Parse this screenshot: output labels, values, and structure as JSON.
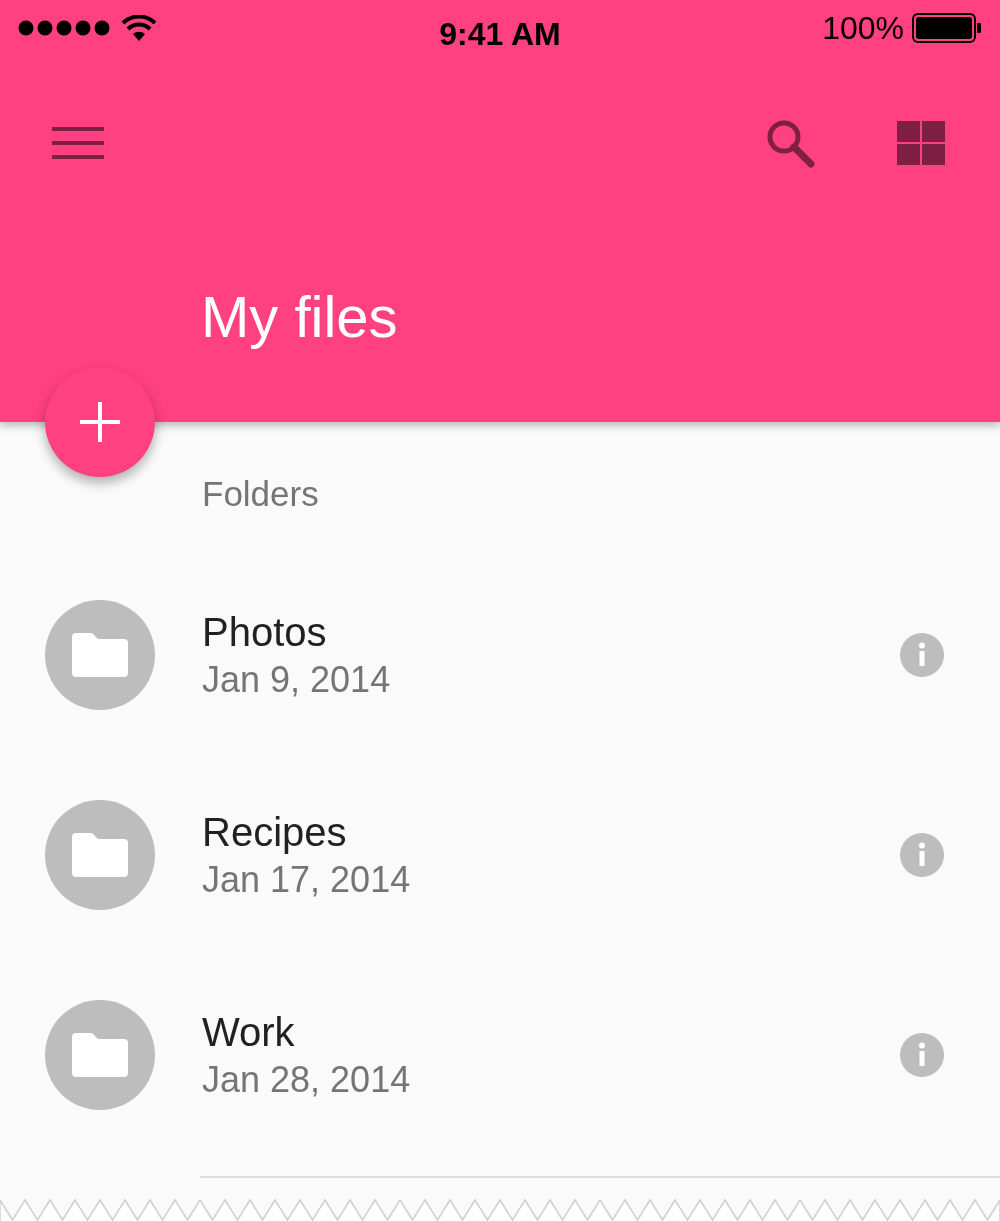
{
  "status_bar": {
    "time": "9:41 AM",
    "battery": "100%"
  },
  "app_bar": {
    "title": "My files"
  },
  "section": {
    "title": "Folders"
  },
  "folders": [
    {
      "name": "Photos",
      "date": "Jan 9, 2014"
    },
    {
      "name": "Recipes",
      "date": "Jan 17, 2014"
    },
    {
      "name": "Work",
      "date": "Jan 28, 2014"
    }
  ]
}
